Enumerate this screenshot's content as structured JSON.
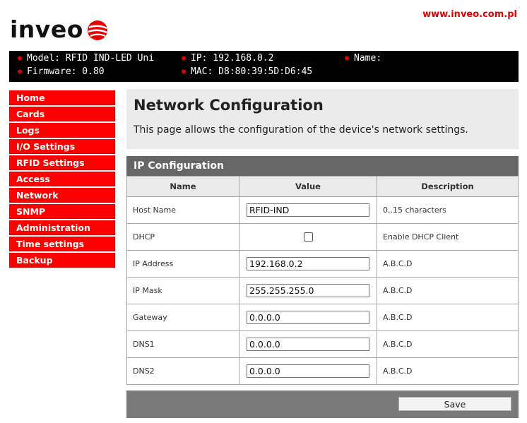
{
  "header": {
    "site_url": "www.inveo.com.pl",
    "logo_text": "inveo"
  },
  "device_info": {
    "model": "Model: RFID IND-LED Uni",
    "firmware": "Firmware: 0.80",
    "ip": "IP: 192.168.0.2",
    "mac": "MAC: D8:80:39:5D:D6:45",
    "name": "Name:"
  },
  "sidebar": {
    "items": [
      {
        "label": "Home"
      },
      {
        "label": "Cards"
      },
      {
        "label": "Logs"
      },
      {
        "label": "I/O Settings"
      },
      {
        "label": "RFID Settings"
      },
      {
        "label": "Access"
      },
      {
        "label": "Network"
      },
      {
        "label": "SNMP"
      },
      {
        "label": "Administration"
      },
      {
        "label": "Time settings"
      },
      {
        "label": "Backup"
      }
    ]
  },
  "page": {
    "title": "Network Configuration",
    "description": "This page allows the configuration of the device's network settings."
  },
  "ip_config": {
    "section_title": "IP Configuration",
    "columns": [
      "Name",
      "Value",
      "Description"
    ],
    "rows": [
      {
        "name": "Host Name",
        "value": "RFID-IND",
        "description": "0..15 characters"
      },
      {
        "name": "DHCP",
        "checked": false,
        "description": "Enable DHCP Client"
      },
      {
        "name": "IP Address",
        "value": "192.168.0.2",
        "description": "A.B.C.D"
      },
      {
        "name": "IP Mask",
        "value": "255.255.255.0",
        "description": "A.B.C.D"
      },
      {
        "name": "Gateway",
        "value": "0.0.0.0",
        "description": "A.B.C.D"
      },
      {
        "name": "DNS1",
        "value": "0.0.0.0",
        "description": "A.B.C.D"
      },
      {
        "name": "DNS2",
        "value": "0.0.0.0",
        "description": "A.B.C.D"
      }
    ]
  },
  "actions": {
    "save_label": "Save"
  },
  "colors": {
    "brand_red": "#ff0000",
    "info_bar": "#000000",
    "section_header": "#666666"
  },
  "icons": {
    "bullet": "red-dot-icon",
    "logo_mark": "inveo-globe-icon"
  }
}
